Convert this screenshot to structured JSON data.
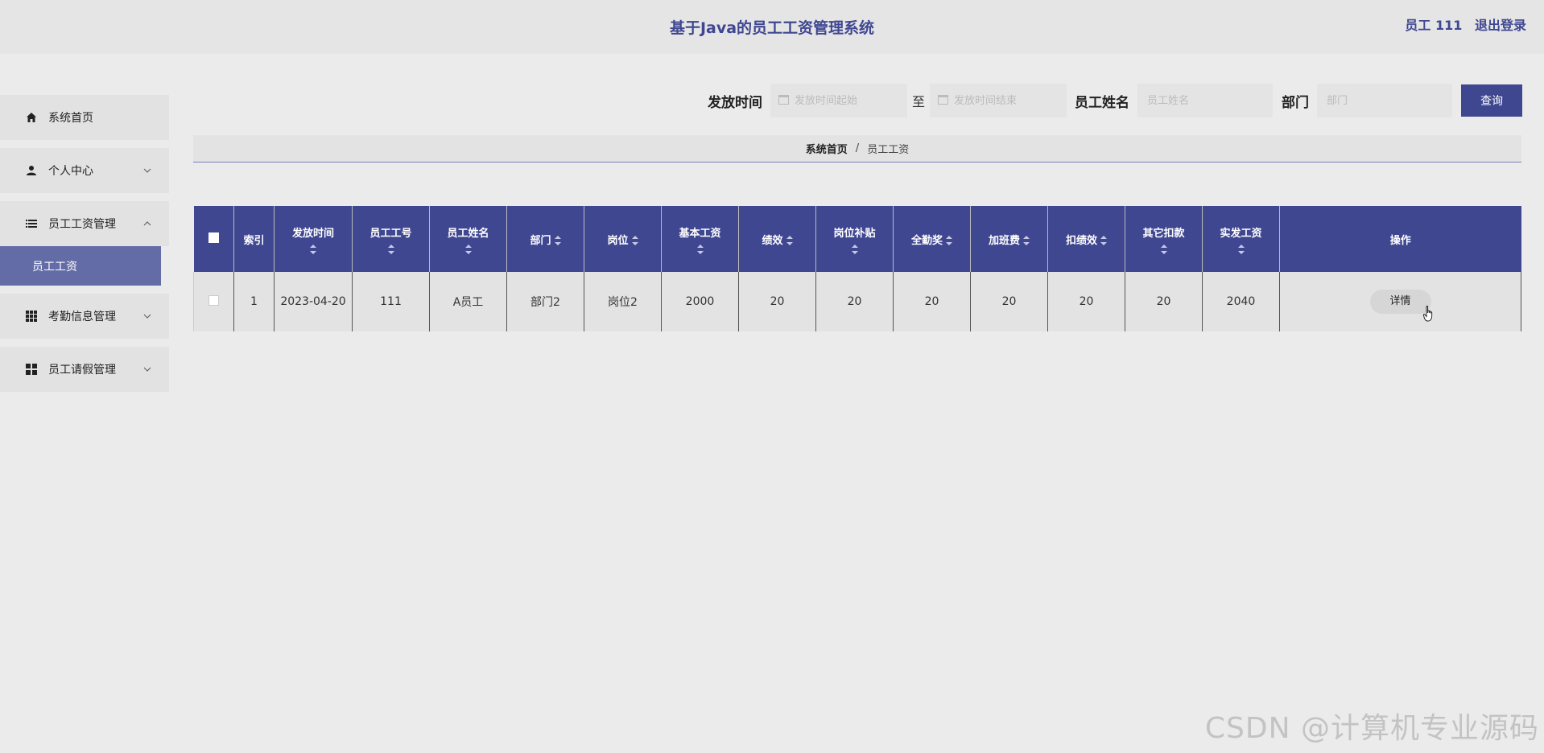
{
  "header": {
    "title": "基于Java的员工工资管理系统",
    "user": "员工 111",
    "logout": "退出登录"
  },
  "sidebar": {
    "items": [
      {
        "label": "系统首页",
        "icon": "home-icon"
      },
      {
        "label": "个人中心",
        "icon": "user-icon"
      },
      {
        "label": "员工工资管理",
        "icon": "list-icon",
        "open": true,
        "children": [
          {
            "label": "员工工资"
          }
        ]
      },
      {
        "label": "考勤信息管理",
        "icon": "grid-icon"
      },
      {
        "label": "员工请假管理",
        "icon": "apps-icon"
      }
    ]
  },
  "search": {
    "date_label": "发放时间",
    "date_start_placeholder": "发放时间起始",
    "date_sep": "至",
    "date_end_placeholder": "发放时间结束",
    "name_label": "员工姓名",
    "name_placeholder": "员工姓名",
    "dept_label": "部门",
    "dept_placeholder": "部门",
    "query_button": "查询"
  },
  "breadcrumb": {
    "home": "系统首页",
    "sep": "/",
    "current": "员工工资"
  },
  "table": {
    "columns": [
      "索引",
      "发放时间",
      "员工工号",
      "员工姓名",
      "部门",
      "岗位",
      "基本工资",
      "绩效",
      "岗位补贴",
      "全勤奖",
      "加班费",
      "扣绩效",
      "其它扣款",
      "实发工资",
      "操作"
    ],
    "rows": [
      {
        "index": "1",
        "date": "2023-04-20",
        "emp_no": "111",
        "emp_name": "A员工",
        "dept": "部门2",
        "post": "岗位2",
        "base": "2000",
        "perf": "20",
        "allowance": "20",
        "attendance": "20",
        "overtime": "20",
        "perf_deduct": "20",
        "other_deduct": "20",
        "net": "2040",
        "action": "详情"
      }
    ]
  },
  "watermark": "CSDN @计算机专业源码",
  "colors": {
    "primary": "#3f4791",
    "submenu_active": "#646ca7"
  }
}
